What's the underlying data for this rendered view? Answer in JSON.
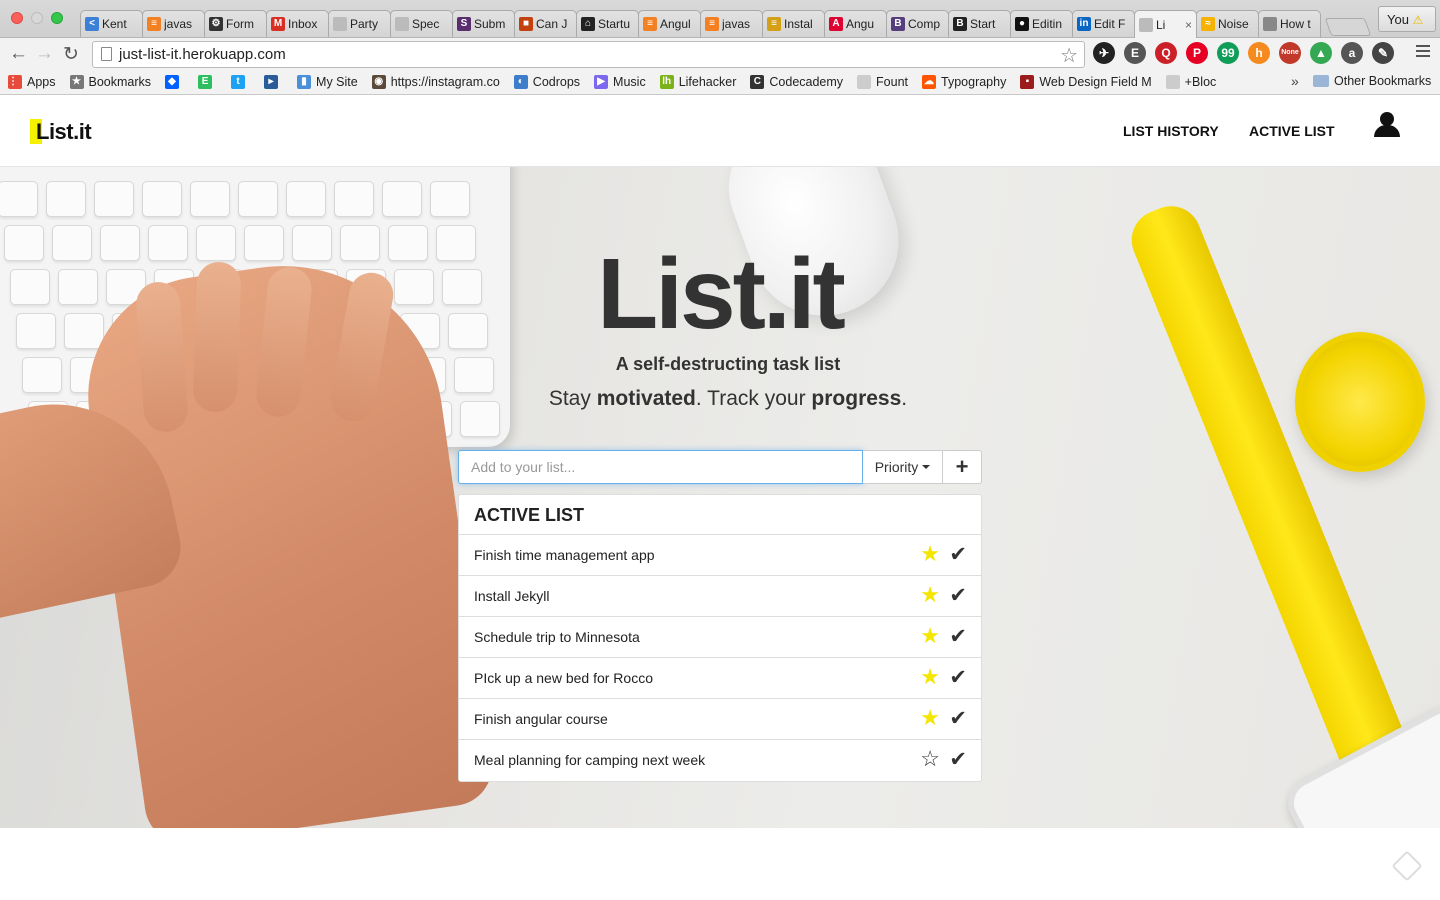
{
  "browser": {
    "tabs": [
      {
        "label": "Kent",
        "icon": "kent-icon",
        "color": "#3b7fd6",
        "glyph": "<"
      },
      {
        "label": "javas",
        "icon": "stackoverflow-icon",
        "color": "#f48024",
        "glyph": "≡"
      },
      {
        "label": "Form",
        "icon": "formspree-icon",
        "color": "#333333",
        "glyph": "⚙"
      },
      {
        "label": "Inbox",
        "icon": "gmail-icon",
        "color": "#d93025",
        "glyph": "M"
      },
      {
        "label": "Party",
        "icon": "page-icon",
        "color": "#bbbbbb",
        "glyph": ""
      },
      {
        "label": "Spec",
        "icon": "page-icon",
        "color": "#bbbbbb",
        "glyph": ""
      },
      {
        "label": "Subm",
        "icon": "submit-icon",
        "color": "#5a2d6e",
        "glyph": "S"
      },
      {
        "label": "Can J",
        "icon": "caniuse-icon",
        "color": "#c2410c",
        "glyph": "■"
      },
      {
        "label": "Startu",
        "icon": "home-icon",
        "color": "#222222",
        "glyph": "⌂"
      },
      {
        "label": "Angul",
        "icon": "stackoverflow-icon",
        "color": "#f48024",
        "glyph": "≡"
      },
      {
        "label": "javas",
        "icon": "stackoverflow-icon",
        "color": "#f48024",
        "glyph": "≡"
      },
      {
        "label": "Instal",
        "icon": "jekyll-icon",
        "color": "#d4a017",
        "glyph": "≡"
      },
      {
        "label": "Angu",
        "icon": "angular-icon",
        "color": "#dd0031",
        "glyph": "A"
      },
      {
        "label": "Comp",
        "icon": "bootstrap-icon",
        "color": "#563d7c",
        "glyph": "B"
      },
      {
        "label": "Start",
        "icon": "bootstrap-dark-icon",
        "color": "#222222",
        "glyph": "B"
      },
      {
        "label": "Editin",
        "icon": "github-icon",
        "color": "#111111",
        "glyph": "●"
      },
      {
        "label": "Edit F",
        "icon": "linkedin-icon",
        "color": "#0a66c2",
        "glyph": "in"
      },
      {
        "label": "Li",
        "icon": "page-icon",
        "color": "#bbbbbb",
        "glyph": "",
        "active": true,
        "close": "×"
      },
      {
        "label": "Noise",
        "icon": "noise-icon",
        "color": "#f5b300",
        "glyph": "≈"
      },
      {
        "label": "How t",
        "icon": "apple-icon",
        "color": "#888888",
        "glyph": ""
      }
    ],
    "profile": {
      "label": "You",
      "warning_icon": "⚠"
    },
    "url": "just-list-it.herokuapp.com",
    "bookmarks": [
      {
        "label": "Apps",
        "icon": "apps-grid-icon",
        "color": "#e84a3c",
        "glyph": "⋮⋮"
      },
      {
        "label": "Bookmarks",
        "icon": "star-icon",
        "color": "#777777",
        "glyph": "★"
      },
      {
        "label": "",
        "icon": "dropbox-icon",
        "color": "#0061fe",
        "glyph": "◆"
      },
      {
        "label": "",
        "icon": "evernote-icon",
        "color": "#2dbe60",
        "glyph": "E"
      },
      {
        "label": "",
        "icon": "twitter-icon",
        "color": "#1da1f2",
        "glyph": "t"
      },
      {
        "label": "",
        "icon": "blue-square-icon",
        "color": "#2a5c9a",
        "glyph": "▸"
      },
      {
        "label": "My Site",
        "icon": "chart-icon",
        "color": "#4a90d9",
        "glyph": "▮"
      },
      {
        "label": "https://instagram.co",
        "icon": "instagram-icon",
        "color": "#5b4a3a",
        "glyph": "◉"
      },
      {
        "label": "Codrops",
        "icon": "codrops-icon",
        "color": "#3d7dca",
        "glyph": "◐"
      },
      {
        "label": "Music",
        "icon": "music-icon",
        "color": "#7b68ee",
        "glyph": "▶"
      },
      {
        "label": "Lifehacker",
        "icon": "lifehacker-icon",
        "color": "#7ab317",
        "glyph": "lh"
      },
      {
        "label": "Codecademy",
        "icon": "codecademy-icon",
        "color": "#333333",
        "glyph": "C"
      },
      {
        "label": "Fount",
        "icon": "page-icon",
        "color": "#cccccc",
        "glyph": ""
      },
      {
        "label": "Typography",
        "icon": "soundcloud-icon",
        "color": "#ff5500",
        "glyph": "☁"
      },
      {
        "label": "Web Design Field M",
        "icon": "webdesign-icon",
        "color": "#9b1c1c",
        "glyph": "▪"
      },
      {
        "label": "+Bloc",
        "icon": "page-icon",
        "color": "#cccccc",
        "glyph": ""
      }
    ],
    "bookmarks_more": "»",
    "other_bookmarks": "Other Bookmarks",
    "extensions": [
      {
        "name": "extension-1-icon",
        "color": "#222222",
        "glyph": "✈"
      },
      {
        "name": "evernote-elephant-icon",
        "color": "#555555",
        "glyph": "E"
      },
      {
        "name": "lastpass-icon",
        "color": "#cc2029",
        "glyph": "Q"
      },
      {
        "name": "pinterest-icon",
        "color": "#e60023",
        "glyph": "P"
      },
      {
        "name": "hangouts-icon",
        "color": "#0f9d58",
        "glyph": "99"
      },
      {
        "name": "honey-icon",
        "color": "#f58b1f",
        "glyph": "h"
      },
      {
        "name": "dev-tool-icon",
        "color": "#c0392b",
        "glyph": "None"
      },
      {
        "name": "google-drive-icon",
        "color": "#34a853",
        "glyph": "▲"
      },
      {
        "name": "amazon-icon",
        "color": "#555555",
        "glyph": "a"
      },
      {
        "name": "eyedropper-icon",
        "color": "#444444",
        "glyph": "✎"
      }
    ]
  },
  "site": {
    "logo": "List.it",
    "nav": [
      "LIST HISTORY",
      "ACTIVE LIST"
    ],
    "hero_title": "List.it",
    "tagline": "A self-destructing task list",
    "motto": {
      "part1": "Stay ",
      "bold1": "motivated",
      "part2": ". Track your ",
      "bold2": "progress",
      "part3": "."
    },
    "input_placeholder": "Add to your list...",
    "priority_label": "Priority",
    "add_label": "+",
    "list_title": "ACTIVE LIST",
    "tasks": [
      {
        "text": "Finish time management app",
        "starred": true
      },
      {
        "text": "Install Jekyll",
        "starred": true
      },
      {
        "text": "Schedule trip to Minnesota",
        "starred": true
      },
      {
        "text": "PIck up a new bed for Rocco",
        "starred": true
      },
      {
        "text": "Finish angular course",
        "starred": true
      },
      {
        "text": "Meal planning for camping next week",
        "starred": false
      }
    ],
    "colors": {
      "accent": "#f5ef00",
      "star": "#f5e600",
      "input_focus": "#66afe9"
    }
  }
}
